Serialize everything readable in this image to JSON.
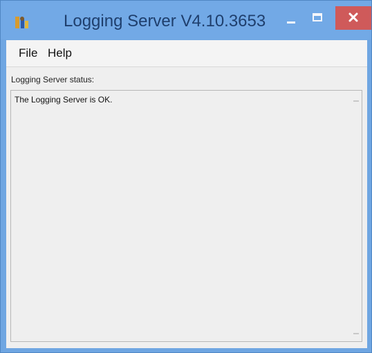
{
  "window": {
    "title": "Logging Server V4.10.3653",
    "app_icon": "logging-server-app-icon",
    "buttons": {
      "minimize_icon": "minimize-icon",
      "maximize_icon": "maximize-icon",
      "close_icon": "close-icon"
    },
    "colors": {
      "titlebar": "#72a9e6",
      "close_button": "#cf5a5a",
      "client_background": "#efefef"
    }
  },
  "menu": {
    "items": [
      "File",
      "Help"
    ]
  },
  "main": {
    "status_label": "Logging Server status:",
    "log_text": "The Logging Server is OK."
  }
}
